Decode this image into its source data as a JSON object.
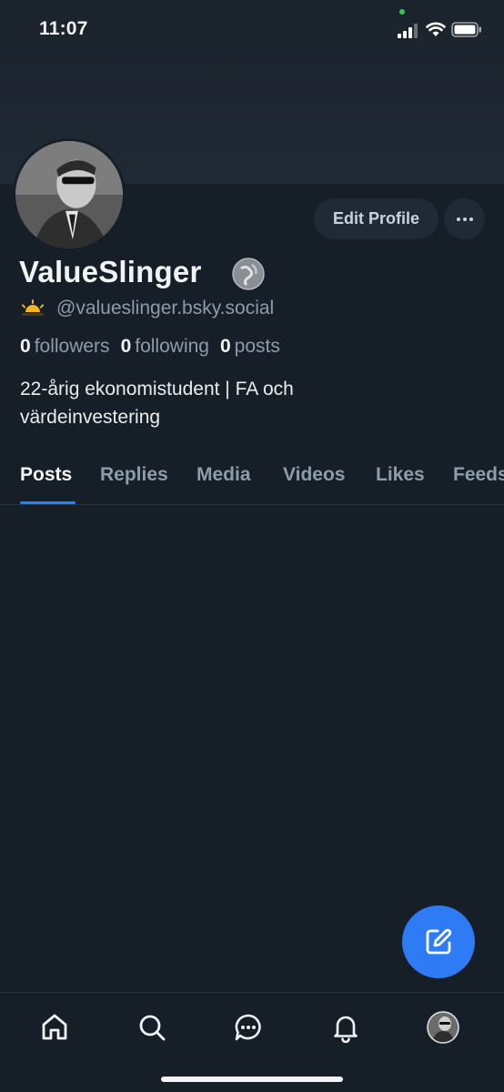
{
  "status_bar": {
    "time": "11:07",
    "icons": [
      "camera-indicator-dot",
      "cellular-signal-icon",
      "wifi-icon",
      "battery-icon"
    ]
  },
  "profile": {
    "display_name": "ValueSlinger",
    "name_badge_icon": "globe-badge-icon",
    "handle_emoji_icon": "sunrise-emoji-icon",
    "handle": "@valueslinger.bsky.social",
    "followers_count": "0",
    "followers_label": "followers",
    "following_count": "0",
    "following_label": "following",
    "posts_count": "0",
    "posts_label": "posts",
    "bio": "22-årig ekonomistudent | FA och värdeinvestering",
    "edit_button_label": "Edit Profile",
    "more_icon": "ellipsis-icon"
  },
  "tabs": [
    {
      "label": "Posts",
      "active": true
    },
    {
      "label": "Replies",
      "active": false
    },
    {
      "label": "Media",
      "active": false
    },
    {
      "label": "Videos",
      "active": false
    },
    {
      "label": "Likes",
      "active": false
    },
    {
      "label": "Feeds",
      "active": false
    }
  ],
  "compose_icon": "compose-icon",
  "bottom_nav": [
    "home-icon",
    "search-icon",
    "chat-icon",
    "bell-icon",
    "profile-avatar"
  ],
  "colors": {
    "background": "#161e27",
    "banner": "#1e2832",
    "accent": "#1e83ff",
    "fab": "#2f7bf5",
    "muted_text": "#8d9bab",
    "button_bg": "#1f2a36"
  }
}
